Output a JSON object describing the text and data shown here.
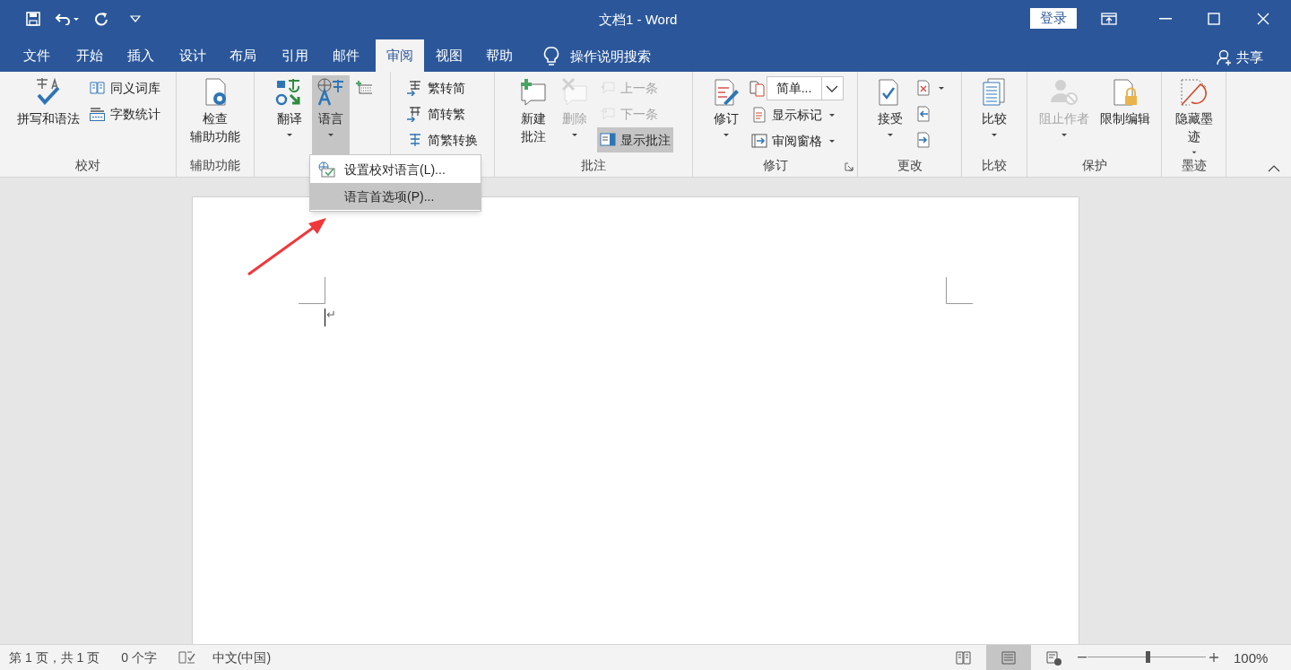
{
  "title_bar": {
    "title": "文档1 - Word",
    "login": "登录"
  },
  "tabs": [
    {
      "label": "文件",
      "selected": false
    },
    {
      "label": "开始",
      "selected": false
    },
    {
      "label": "插入",
      "selected": false
    },
    {
      "label": "设计",
      "selected": false
    },
    {
      "label": "布局",
      "selected": false
    },
    {
      "label": "引用",
      "selected": false
    },
    {
      "label": "邮件",
      "selected": false
    },
    {
      "label": "审阅",
      "selected": true
    },
    {
      "label": "视图",
      "selected": false
    },
    {
      "label": "帮助",
      "selected": false
    }
  ],
  "tell_me": {
    "placeholder": "操作说明搜索"
  },
  "share": "共享",
  "ribbon": {
    "groups": [
      {
        "label": "校对",
        "items": [
          {
            "kind": "large",
            "lines": [
              "拼写和语法"
            ],
            "dropdown": false,
            "disabled": false,
            "selected": false
          },
          {
            "kind": "stack",
            "items": [
              {
                "label": "同义词库",
                "disabled": false,
                "selected": false,
                "dropdown": false
              },
              {
                "label": "字数统计",
                "disabled": false,
                "selected": false,
                "dropdown": false
              }
            ]
          }
        ]
      },
      {
        "label": "辅助功能",
        "items": [
          {
            "kind": "large",
            "lines": [
              "检查",
              "辅助功能"
            ],
            "dropdown": false,
            "disabled": false,
            "selected": false
          }
        ]
      },
      {
        "items": [
          {
            "kind": "large",
            "lines": [
              "翻译"
            ],
            "dropdown": true,
            "disabled": false,
            "selected": false
          },
          {
            "kind": "large",
            "lines": [
              "语言"
            ],
            "dropdown": true,
            "disabled": false,
            "selected": true
          },
          {
            "kind": "stack",
            "items": [
              {
                "disabled": false,
                "selected": false,
                "dropdown": false
              }
            ]
          }
        ]
      },
      {
        "items": [
          {
            "kind": "stack",
            "items": [
              {
                "label": "繁转简",
                "disabled": false,
                "selected": false,
                "dropdown": false
              },
              {
                "label": "简转繁",
                "disabled": false,
                "selected": false,
                "dropdown": false
              },
              {
                "label": "简繁转换",
                "disabled": false,
                "selected": false,
                "dropdown": false
              }
            ]
          }
        ]
      },
      {
        "label": "批注",
        "items": [
          {
            "kind": "large",
            "lines": [
              "新建",
              "批注"
            ],
            "dropdown": false,
            "disabled": false,
            "selected": false
          },
          {
            "kind": "large",
            "lines": [
              "删除"
            ],
            "dropdown": true,
            "disabled": true,
            "selected": false
          },
          {
            "kind": "stack",
            "items": [
              {
                "label": "上一条",
                "disabled": true,
                "selected": false,
                "dropdown": false
              },
              {
                "label": "下一条",
                "disabled": true,
                "selected": false,
                "dropdown": false
              },
              {
                "label": "显示批注",
                "disabled": false,
                "selected": true,
                "dropdown": false
              }
            ]
          }
        ]
      },
      {
        "label": "修订",
        "launcher": true,
        "items": [
          {
            "kind": "large",
            "lines": [
              "修订"
            ],
            "dropdown": true,
            "disabled": false,
            "selected": false
          },
          {
            "kind": "stack",
            "items": [
              {
                "kind": "combo",
                "label": "简单..."
              },
              {
                "label": "显示标记",
                "disabled": false,
                "selected": false,
                "dropdown": true
              },
              {
                "label": "审阅窗格",
                "disabled": false,
                "selected": false,
                "dropdown": true
              }
            ]
          }
        ]
      },
      {
        "label": "更改",
        "items": [
          {
            "kind": "large",
            "lines": [
              "接受"
            ],
            "dropdown": true,
            "disabled": false,
            "selected": false
          },
          {
            "kind": "stack",
            "items": [
              {
                "disabled": false,
                "selected": false,
                "dropdown": true
              },
              {
                "disabled": false,
                "selected": false,
                "dropdown": false
              },
              {
                "disabled": false,
                "selected": false,
                "dropdown": false
              }
            ]
          }
        ]
      },
      {
        "label": "比较",
        "items": [
          {
            "kind": "large",
            "lines": [
              "比较"
            ],
            "dropdown": true,
            "disabled": false,
            "selected": false
          }
        ]
      },
      {
        "label": "保护",
        "items": [
          {
            "kind": "large",
            "lines": [
              "阻止作者"
            ],
            "dropdown": true,
            "disabled": true,
            "selected": false
          },
          {
            "kind": "large",
            "lines": [
              "限制编辑"
            ],
            "dropdown": false,
            "disabled": false,
            "selected": false
          }
        ]
      },
      {
        "label": "墨迹",
        "items": [
          {
            "kind": "large",
            "lines": [
              "隐藏墨",
              "迹"
            ],
            "dropdown": true,
            "disabled": false,
            "selected": false
          }
        ]
      }
    ]
  },
  "menu": {
    "items": [
      {
        "label": "设置校对语言(L)...",
        "selected": false
      },
      {
        "label": "语言首选项(P)...",
        "selected": true
      }
    ]
  },
  "document": {
    "paragraph_mark": "↵"
  },
  "status_bar": {
    "page": "第 1 页，共 1 页",
    "words": "0 个字",
    "language": "中文(中国)",
    "views": [
      {
        "selected": false
      },
      {
        "selected": true
      },
      {
        "selected": false
      }
    ],
    "zoom": {
      "level": 0.51,
      "reading": "100%"
    }
  }
}
